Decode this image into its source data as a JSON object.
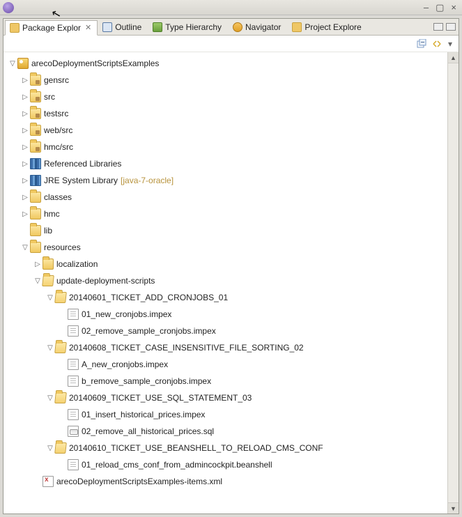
{
  "window": {
    "min": "–",
    "max": "▢",
    "close": "×"
  },
  "tabs": {
    "package_explorer": "Package Explor",
    "outline": "Outline",
    "type_hierarchy": "Type Hierarchy",
    "navigator": "Navigator",
    "project_explorer": "Project Explore"
  },
  "tree": {
    "project": "arecoDeploymentScriptsExamples",
    "gensrc": "gensrc",
    "src": "src",
    "testsrc": "testsrc",
    "websrc": "web/src",
    "hmcsrc": "hmc/src",
    "reflib": "Referenced Libraries",
    "jre": "JRE System Library",
    "jre_suffix": "[java-7-oracle]",
    "classes": "classes",
    "hmc": "hmc",
    "lib": "lib",
    "resources": "resources",
    "localization": "localization",
    "uds": "update-deployment-scripts",
    "t1": "20140601_TICKET_ADD_CRONJOBS_01",
    "t1f1": "01_new_cronjobs.impex",
    "t1f2": "02_remove_sample_cronjobs.impex",
    "t2": "20140608_TICKET_CASE_INSENSITIVE_FILE_SORTING_02",
    "t2f1": "A_new_cronjobs.impex",
    "t2f2": "b_remove_sample_cronjobs.impex",
    "t3": "20140609_TICKET_USE_SQL_STATEMENT_03",
    "t3f1": "01_insert_historical_prices.impex",
    "t3f2": "02_remove_all_historical_prices.sql",
    "t4": "20140610_TICKET_USE_BEANSHELL_TO_RELOAD_CMS_CONF",
    "t4f1": "01_reload_cms_conf_from_admincockpit.beanshell",
    "itemsxml": "arecoDeploymentScriptsExamples-items.xml"
  }
}
